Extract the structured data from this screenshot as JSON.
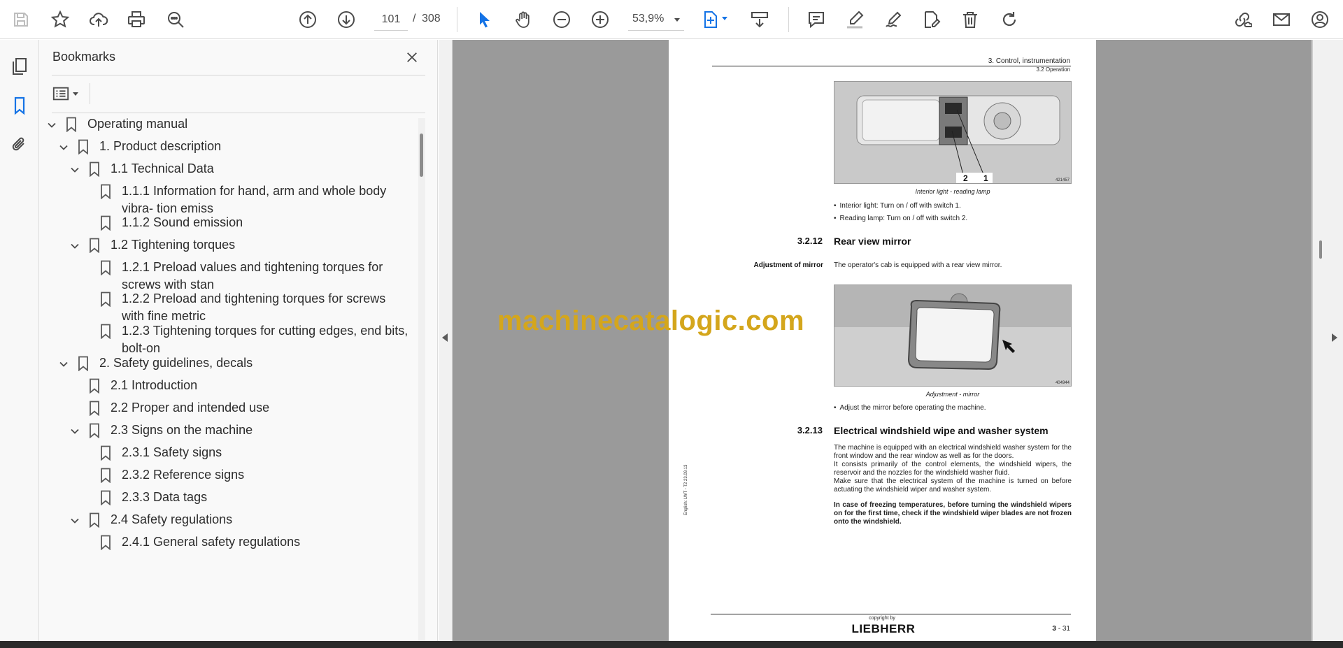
{
  "toolbar": {
    "page_current": "101",
    "page_separator": "/",
    "page_total": "308",
    "zoom": "53,9%"
  },
  "panel": {
    "title": "Bookmarks"
  },
  "bookmarks": [
    {
      "label": "Operating manual",
      "level": 0,
      "expandable": true
    },
    {
      "label": "1. Product description",
      "level": 1,
      "expandable": true
    },
    {
      "label": "1.1 Technical Data",
      "level": 2,
      "expandable": true
    },
    {
      "label": "1.1.1 Information for hand, arm and whole body",
      "label2": "vibra- tion emiss",
      "level": 3,
      "expandable": false
    },
    {
      "label": "1.1.2 Sound emission",
      "level": 3,
      "expandable": false
    },
    {
      "label": "1.2 Tightening torques",
      "level": 2,
      "expandable": true
    },
    {
      "label": "1.2.1 Preload values and tightening torques for",
      "label2": "screws with stan",
      "level": 3,
      "expandable": false
    },
    {
      "label": "1.2.2 Preload and tightening torques for screws",
      "label2": "with fine metric",
      "level": 3,
      "expandable": false
    },
    {
      "label": "1.2.3 Tightening torques for cutting edges, end bits,",
      "label2": "bolt-on",
      "level": 3,
      "expandable": false
    },
    {
      "label": "2. Safety guidelines, decals",
      "level": 1,
      "expandable": true
    },
    {
      "label": "2.1 Introduction",
      "level": 2,
      "expandable": false
    },
    {
      "label": "2.2 Proper and intended use",
      "level": 2,
      "expandable": false
    },
    {
      "label": "2.3 Signs on the machine",
      "level": 2,
      "expandable": true
    },
    {
      "label": "2.3.1 Safety signs",
      "level": 3,
      "expandable": false
    },
    {
      "label": "2.3.2 Reference signs",
      "level": 3,
      "expandable": false
    },
    {
      "label": "2.3.3 Data tags",
      "level": 3,
      "expandable": false
    },
    {
      "label": "2.4 Safety regulations",
      "level": 2,
      "expandable": true
    },
    {
      "label": "2.4.1 General safety regulations",
      "level": 3,
      "expandable": false
    }
  ],
  "document": {
    "header_chapter": "3. Control, instrumentation",
    "header_section": "3.2 Operation",
    "fig1_label_2": "2",
    "fig1_label_1": "1",
    "fig1_number": "421457",
    "fig1_caption": "Interior light - reading lamp",
    "bullet1": "Interior light: Turn on / off with switch 1.",
    "bullet2": "Reading lamp: Turn on / off with switch 2.",
    "sec1_num": "3.2.12",
    "sec1_title": "Rear view mirror",
    "side_label": "Adjustment of mirror",
    "sec1_text": "The operator's cab is equipped with a rear view mirror.",
    "fig2_number": "404944",
    "fig2_caption": "Adjustment - mirror",
    "bullet3": "Adjust the mirror before operating the machine.",
    "sec2_num": "3.2.13",
    "sec2_title": "Electrical windshield wipe and washer system",
    "para1": "The machine is equipped with an electrical windshield washer system for the front window and the rear window as well as for the doors.",
    "para2": "It consists primarily of the control elements, the windshield wipers, the reservoir and the nozzles for the windshield washer fluid.",
    "para3": "Make sure that the electrical system of the machine is turned on before actuating the windshield wiper and washer system.",
    "para_bold": "In case of freezing temperatures, before turning the windshield wipers on for the first time, check if the windshield wiper blades are not frozen onto the windshield.",
    "vertical_text": "English: LWT - T2 23.09.13",
    "copyright": "copyright by",
    "brand": "LIEBHERR",
    "page_chapter": "3",
    "page_sep": " - ",
    "page_num": "31"
  },
  "watermark": "machinecatalogic.com"
}
